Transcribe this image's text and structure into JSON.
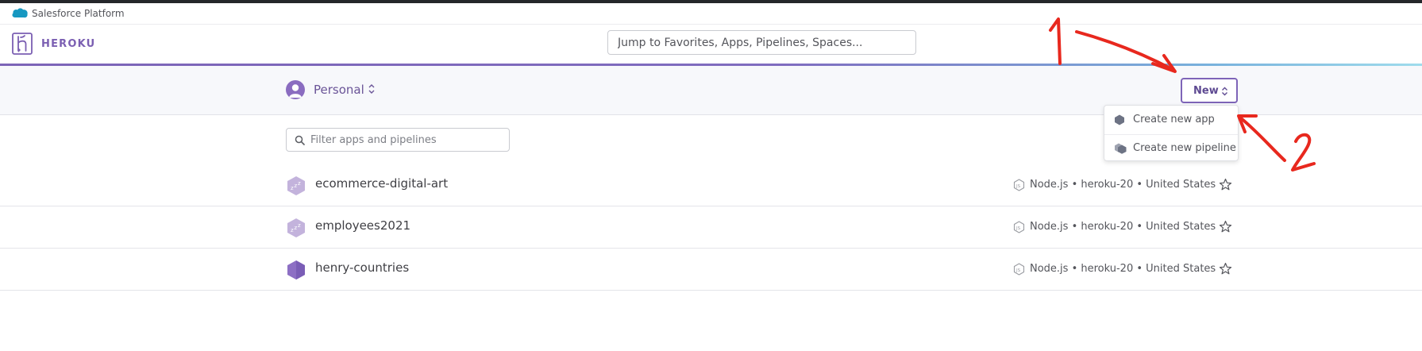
{
  "platform_bar": {
    "label": "Salesforce Platform"
  },
  "header": {
    "brand": "HEROKU",
    "search": {
      "placeholder": "Jump to Favorites, Apps, Pipelines, Spaces..."
    }
  },
  "subheader": {
    "account": "Personal",
    "new_button": "New"
  },
  "new_menu": {
    "items": [
      {
        "label": "Create new app",
        "icon": "app-hexagon-icon"
      },
      {
        "label": "Create new pipeline",
        "icon": "pipeline-icon"
      }
    ]
  },
  "filter": {
    "placeholder": "Filter apps and pipelines"
  },
  "apps": [
    {
      "name": "ecommerce-digital-art",
      "state": "sleeping",
      "meta": "Node.js • heroku-20 • United States"
    },
    {
      "name": "employees2021",
      "state": "sleeping",
      "meta": "Node.js • heroku-20 • United States"
    },
    {
      "name": "henry-countries",
      "state": "active",
      "meta": "Node.js • heroku-20 • United States"
    }
  ],
  "annotations": {
    "marker_1": "1",
    "marker_2": "2",
    "color": "#e8281e"
  },
  "colors": {
    "brand_purple": "#7e64b8",
    "dark_topline": "#25272b",
    "subheader_bg": "#f7f8fb"
  }
}
